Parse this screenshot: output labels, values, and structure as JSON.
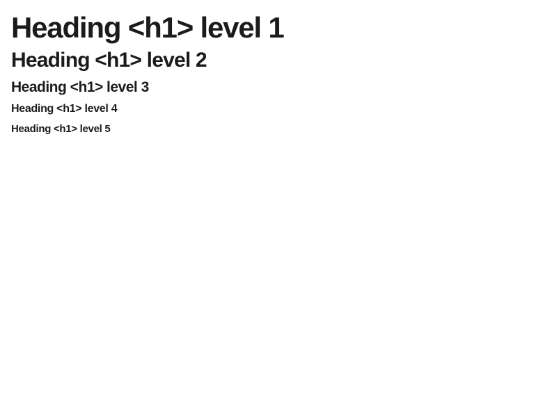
{
  "headings": [
    {
      "level": 1,
      "text": "Heading <h1> level 1"
    },
    {
      "level": 2,
      "text": "Heading <h1> level 2"
    },
    {
      "level": 3,
      "text": "Heading <h1> level 3"
    },
    {
      "level": 4,
      "text": "Heading <h1> level 4"
    },
    {
      "level": 5,
      "text": "Heading <h1> level 5"
    }
  ],
  "colors": {
    "background": "#ffffff",
    "text": "#1b1b1b"
  }
}
